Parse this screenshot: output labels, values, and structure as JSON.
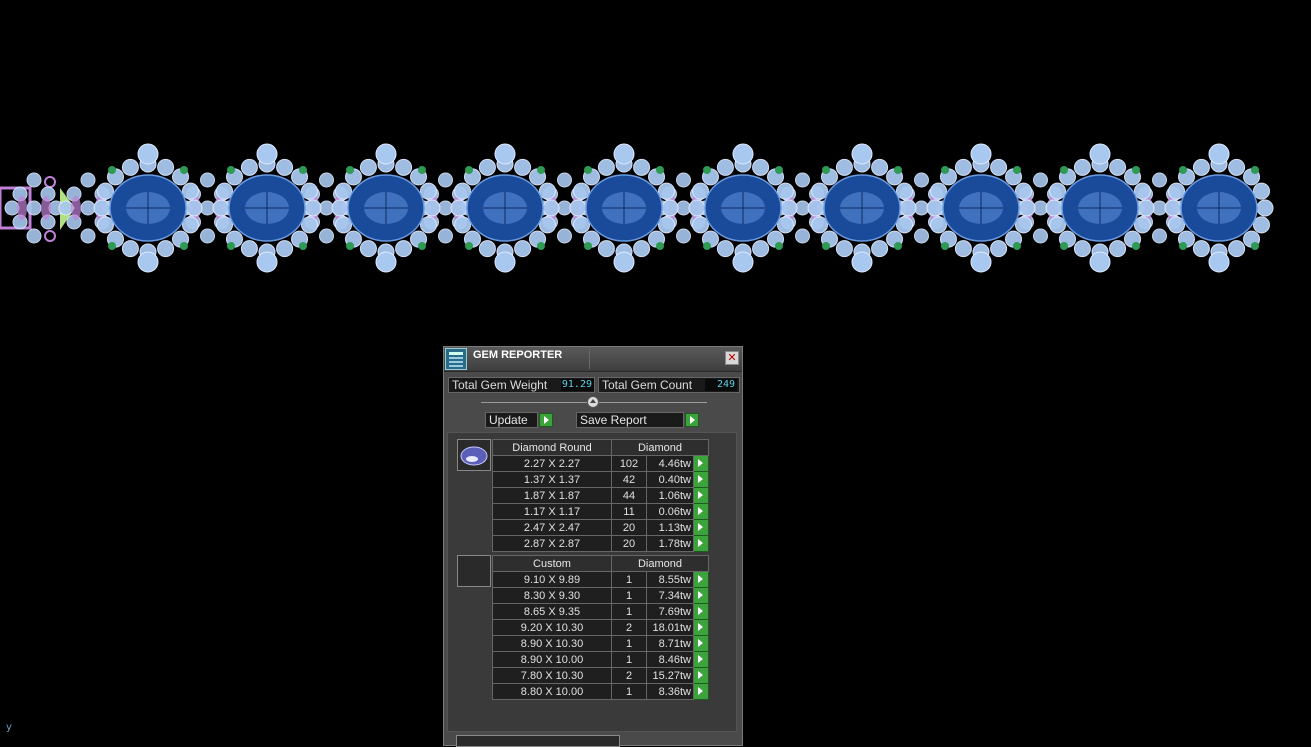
{
  "canvas": {
    "background": "#000000",
    "axis_label": "y",
    "bracelet": {
      "large_stone_color": "#1a4a9a",
      "accent_stone_color": "#a8c8f0",
      "metal_color": "#c080d8",
      "large_stone_count": 10
    }
  },
  "panel": {
    "title": "GEM REPORTER",
    "close_icon": "close-icon",
    "total_weight_label": "Total Gem Weight",
    "total_weight_value": "91.29",
    "total_count_label": "Total Gem Count",
    "total_count_value": "249",
    "update_label": "Update",
    "save_report_label": "Save Report"
  },
  "groups": [
    {
      "shape": "Diamond Round",
      "material": "Diamond",
      "rows": [
        {
          "size": "2.27 X 2.27",
          "count": "102",
          "weight": "4.46tw"
        },
        {
          "size": "1.37 X 1.37",
          "count": "42",
          "weight": "0.40tw"
        },
        {
          "size": "1.87 X 1.87",
          "count": "44",
          "weight": "1.06tw"
        },
        {
          "size": "1.17 X 1.17",
          "count": "11",
          "weight": "0.06tw"
        },
        {
          "size": "2.47 X 2.47",
          "count": "20",
          "weight": "1.13tw"
        },
        {
          "size": "2.87 X 2.87",
          "count": "20",
          "weight": "1.78tw"
        }
      ]
    },
    {
      "shape": "Custom",
      "material": "Diamond",
      "rows": [
        {
          "size": "9.10 X 9.89",
          "count": "1",
          "weight": "8.55tw"
        },
        {
          "size": "8.30 X 9.30",
          "count": "1",
          "weight": "7.34tw"
        },
        {
          "size": "8.65 X 9.35",
          "count": "1",
          "weight": "7.69tw"
        },
        {
          "size": "9.20 X 10.30",
          "count": "2",
          "weight": "18.01tw"
        },
        {
          "size": "8.90 X 10.30",
          "count": "1",
          "weight": "8.71tw"
        },
        {
          "size": "8.90 X 10.00",
          "count": "1",
          "weight": "8.46tw"
        },
        {
          "size": "7.80 X 10.30",
          "count": "2",
          "weight": "15.27tw"
        },
        {
          "size": "8.80 X 10.00",
          "count": "1",
          "weight": "8.36tw"
        }
      ]
    }
  ]
}
